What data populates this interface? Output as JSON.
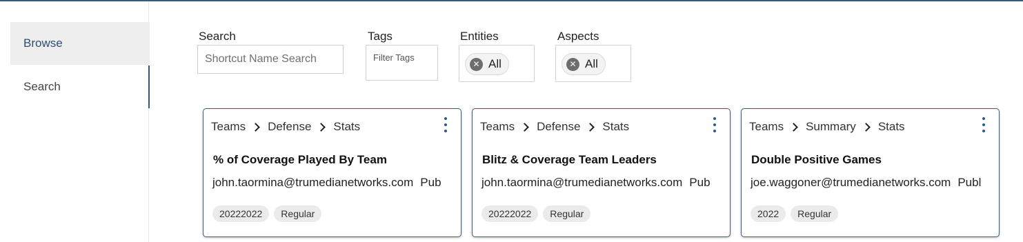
{
  "sidebar": {
    "items": [
      {
        "label": "Browse"
      },
      {
        "label": "Search"
      }
    ]
  },
  "filters": {
    "search_label": "Search",
    "search_placeholder": "Shortcut Name Search",
    "tags_label": "Tags",
    "tags_placeholder": "Filter Tags",
    "entities_label": "Entities",
    "entities_value": "All",
    "aspects_label": "Aspects",
    "aspects_value": "All"
  },
  "cards": [
    {
      "crumbs": [
        "Teams",
        "Defense",
        "Stats"
      ],
      "title": "% of Coverage Played By Team",
      "owner": "john.taormina@trumedianetworks.com",
      "visibility": "Pub",
      "tags": [
        "20222022",
        "Regular"
      ]
    },
    {
      "crumbs": [
        "Teams",
        "Defense",
        "Stats"
      ],
      "title": "Blitz & Coverage Team Leaders",
      "owner": "john.taormina@trumedianetworks.com",
      "visibility": "Pub",
      "tags": [
        "20222022",
        "Regular"
      ]
    },
    {
      "crumbs": [
        "Teams",
        "Summary",
        "Stats"
      ],
      "title": "Double Positive Games",
      "owner": "joe.waggoner@trumedianetworks.com",
      "visibility": "Publ",
      "tags": [
        "2022",
        "Regular"
      ]
    }
  ],
  "colors": {
    "accent": "#2d4f73",
    "card_border": "#3b5f86",
    "sidebar_active_bg": "#eeeeee"
  }
}
